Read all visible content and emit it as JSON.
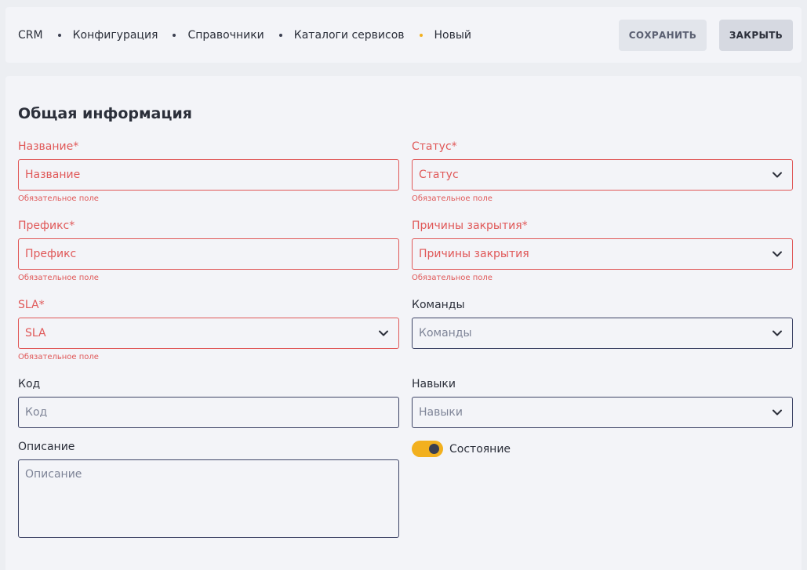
{
  "breadcrumb": [
    {
      "label": "CRM"
    },
    {
      "label": "Конфигурация"
    },
    {
      "label": "Справочники"
    },
    {
      "label": "Каталоги сервисов"
    },
    {
      "label": "Новый"
    }
  ],
  "actions": {
    "save_label": "СОХРАНИТЬ",
    "close_label": "ЗАКРЫТЬ"
  },
  "section_title": "Общая информация",
  "required_hint": "Обязательное поле",
  "fields": {
    "name": {
      "label": "Название*",
      "placeholder": "Название"
    },
    "status": {
      "label": "Статус*",
      "placeholder": "Статус"
    },
    "prefix": {
      "label": "Префикс*",
      "placeholder": "Префикс"
    },
    "close_reasons": {
      "label": "Причины закрытия*",
      "placeholder": "Причины закрытия"
    },
    "sla": {
      "label": "SLA*",
      "placeholder": "SLA"
    },
    "teams": {
      "label": "Команды",
      "placeholder": "Команды"
    },
    "code": {
      "label": "Код",
      "placeholder": "Код"
    },
    "skills": {
      "label": "Навыки",
      "placeholder": "Навыки"
    },
    "description": {
      "label": "Описание",
      "placeholder": "Описание"
    }
  },
  "state_toggle": {
    "label": "Состояние",
    "on": true
  },
  "colors": {
    "accent": "#f2b01e",
    "error": "#e05858",
    "border": "#3d4466"
  }
}
